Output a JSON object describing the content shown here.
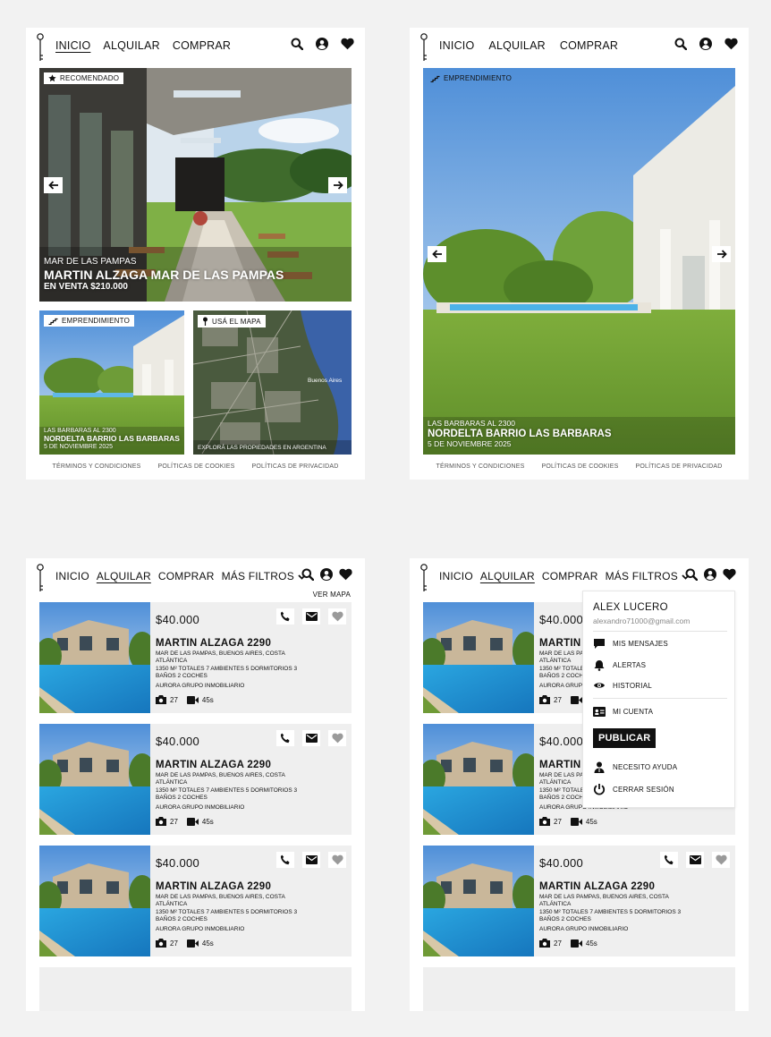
{
  "nav": {
    "inicio": "INICIO",
    "alquilar": "ALQUILAR",
    "comprar": "COMPRAR",
    "mas_filtros": "MÁS FILTROS",
    "ver_mapa": "VER MAPA"
  },
  "home": {
    "featured": {
      "badge": "RECOMENDADO",
      "location": "MAR DE LAS PAMPAS",
      "title": "MARTIN ALZAGA MAR DE LAS PAMPAS",
      "price": "EN VENTA $210.000"
    },
    "emprendimiento": {
      "badge": "EMPRENDIMIENTO",
      "address": "LAS BARBARAS AL 2300",
      "title": "NORDELTA BARRIO LAS BARBARAS",
      "date": "5 DE NOVIEMBRE 2025"
    },
    "map_tile": {
      "badge": "USÁ EL MAPA",
      "caption": "EXPLORÁ LAS PROPIEDADES EN ARGENTINA",
      "city_label": "Buenos Aires"
    },
    "footer": [
      "TÉRMINOS Y CONDICIONES",
      "POLÍTICAS DE COOKIES",
      "POLÍTICAS DE PRIVACIDAD"
    ]
  },
  "detail": {
    "badge": "EMPRENDIMIENTO",
    "address": "LAS BARBARAS AL 2300",
    "title": "NORDELTA BARRIO LAS BARBARAS",
    "date": "5 DE NOVIEMBRE 2025"
  },
  "listing": {
    "price": "$40.000",
    "title": "MARTIN ALZAGA 2290",
    "location": "MAR DE LAS PAMPAS, BUENOS AIRES, COSTA ATLÁNTICA",
    "details": "1350 M² TOTALES 7 AMBIENTES 5 DORMITORIOS 3 BAÑOS 2 COCHES",
    "agency": "AURORA GRUPO INMOBILIARIO",
    "photos": "27",
    "video": "45s"
  },
  "menu": {
    "name": "ALEX LUCERO",
    "email": "alexandro71000@gmail.com",
    "mensajes": "MIS MENSAJES",
    "alertas": "ALERTAS",
    "historial": "HISTORIAL",
    "cuenta": "MI CUENTA",
    "publicar": "PUBLICAR",
    "ayuda": "NECESITO AYUDA",
    "cerrar": "CERRAR SESIÓN"
  },
  "colors": {
    "background": "#f2f2f2",
    "panel": "#ffffff",
    "card": "#efefef",
    "text": "#111111"
  }
}
